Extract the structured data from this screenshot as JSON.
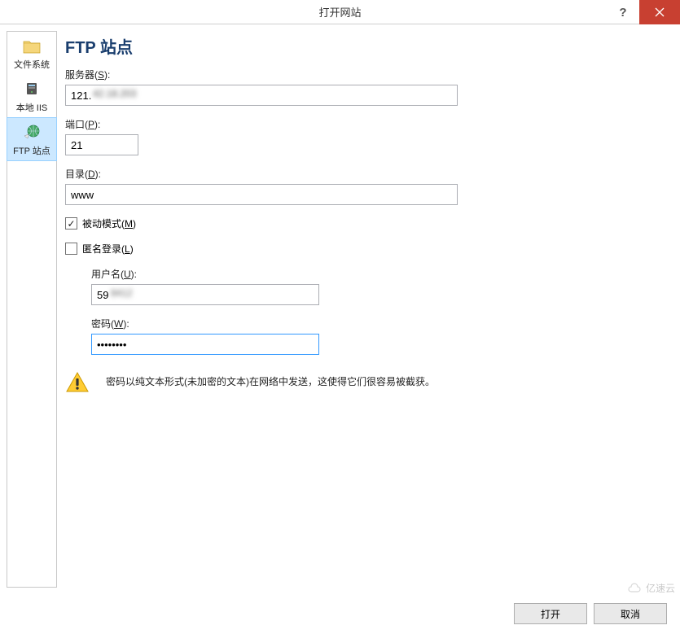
{
  "titlebar": {
    "title": "打开网站",
    "help_label": "?",
    "close_label": "×"
  },
  "sidebar": {
    "items": [
      {
        "label": "文件系统",
        "icon": "folder"
      },
      {
        "label": "本地 IIS",
        "icon": "server"
      },
      {
        "label": "FTP 站点",
        "icon": "globe"
      }
    ]
  },
  "main": {
    "heading": "FTP 站点",
    "server_label_pre": "服务器(",
    "server_label_key": "S",
    "server_label_post": "):",
    "server_value": "121.",
    "port_label_pre": "端口(",
    "port_label_key": "P",
    "port_label_post": "):",
    "port_value": "21",
    "dir_label_pre": "目录(",
    "dir_label_key": "D",
    "dir_label_post": "):",
    "dir_value": "www",
    "passive_label_pre": "被动模式(",
    "passive_label_key": "M",
    "passive_label_post": ")",
    "passive_checked": true,
    "anon_label_pre": "匿名登录(",
    "anon_label_key": "L",
    "anon_label_post": ")",
    "anon_checked": false,
    "user_label_pre": "用户名(",
    "user_label_key": "U",
    "user_label_post": "):",
    "user_value": "59",
    "pass_label_pre": "密码(",
    "pass_label_key": "W",
    "pass_label_post": "):",
    "pass_value": "••••••••",
    "warning_text": "密码以纯文本形式(未加密的文本)在网络中发送，这使得它们很容易被截获。"
  },
  "buttons": {
    "open_label": "打开",
    "cancel_label": "取消"
  },
  "watermark": {
    "text": "亿速云"
  }
}
